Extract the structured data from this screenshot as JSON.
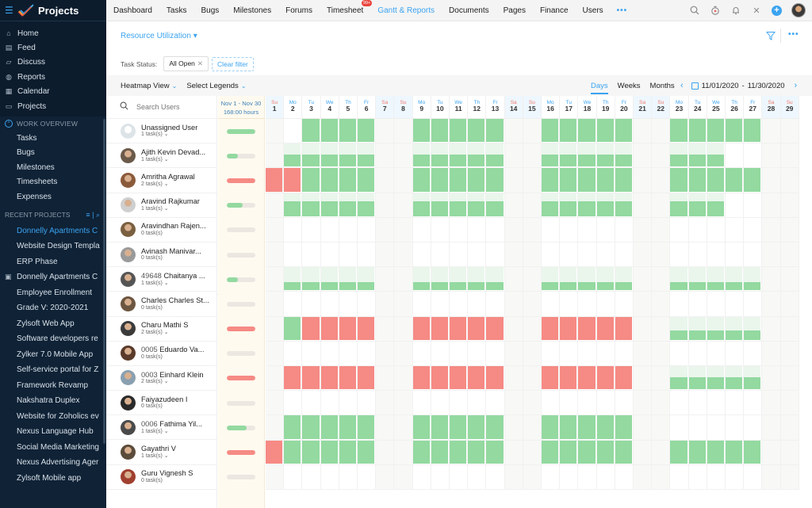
{
  "sidebar": {
    "app_title": "Projects",
    "main_items": [
      {
        "label": "Home",
        "icon": "home-icon",
        "glyph": "⌂"
      },
      {
        "label": "Feed",
        "icon": "feed-icon",
        "glyph": "▤"
      },
      {
        "label": "Discuss",
        "icon": "discuss-icon",
        "glyph": "▱"
      },
      {
        "label": "Reports",
        "icon": "reports-icon",
        "glyph": "◍"
      },
      {
        "label": "Calendar",
        "icon": "calendar-icon",
        "glyph": "▦"
      },
      {
        "label": "Projects",
        "icon": "projects-icon",
        "glyph": "▭"
      }
    ],
    "work_overview_label": "WORK OVERVIEW",
    "work_items": [
      "Tasks",
      "Bugs",
      "Milestones",
      "Timesheets",
      "Expenses"
    ],
    "recent_label": "RECENT PROJECTS",
    "recent_projects": [
      {
        "label": "Donnelly Apartments C",
        "active": true
      },
      {
        "label": "Website Design Templa"
      },
      {
        "label": "ERP Phase"
      },
      {
        "label": "Donnelly Apartments C",
        "icon": true
      },
      {
        "label": "Employee Enrollment"
      },
      {
        "label": "Grade V: 2020-2021"
      },
      {
        "label": "Zylsoft Web App"
      },
      {
        "label": "Software developers re"
      },
      {
        "label": "Zylker 7.0 Mobile App"
      },
      {
        "label": "Self-service portal for Z"
      },
      {
        "label": "Framework Revamp"
      },
      {
        "label": "Nakshatra Duplex"
      },
      {
        "label": "Website for Zoholics ev"
      },
      {
        "label": "Nexus Language Hub"
      },
      {
        "label": "Social Media Marketing"
      },
      {
        "label": "Nexus Advertising Ager"
      },
      {
        "label": "Zylsoft Mobile app"
      }
    ]
  },
  "topnav": {
    "items": [
      "Dashboard",
      "Tasks",
      "Bugs",
      "Milestones",
      "Forums",
      "Timesheet",
      "Gantt & Reports",
      "Documents",
      "Pages",
      "Finance",
      "Users"
    ],
    "active_index": 6,
    "timesheet_badge": "99+",
    "more": "•••"
  },
  "header": {
    "report_selector": "Resource Utilization",
    "task_status_label": "Task Status:",
    "task_status_value": "All Open",
    "clear_filter": "Clear filter",
    "more": "•••"
  },
  "toolbar": {
    "view_selector": "Heatmap View",
    "legends_selector": "Select Legends",
    "views": [
      "Days",
      "Weeks",
      "Months"
    ],
    "active_view": "Days",
    "date_from": "11/01/2020",
    "date_sep": "-",
    "date_to": "11/30/2020"
  },
  "grid": {
    "search_placeholder": "Search Users",
    "summary_range": "Nov 1 - Nov 30",
    "summary_hours": "168:00 hours",
    "days": [
      {
        "d": "Su",
        "n": 1
      },
      {
        "d": "Mo",
        "n": 2
      },
      {
        "d": "Tu",
        "n": 3
      },
      {
        "d": "We",
        "n": 4
      },
      {
        "d": "Th",
        "n": 5
      },
      {
        "d": "Fr",
        "n": 6
      },
      {
        "d": "Sa",
        "n": 7
      },
      {
        "d": "Su",
        "n": 8
      },
      {
        "d": "Mo",
        "n": 9
      },
      {
        "d": "Tu",
        "n": 10
      },
      {
        "d": "We",
        "n": 11
      },
      {
        "d": "Th",
        "n": 12
      },
      {
        "d": "Fr",
        "n": 13
      },
      {
        "d": "Sa",
        "n": 14
      },
      {
        "d": "Su",
        "n": 15
      },
      {
        "d": "Mo",
        "n": 16
      },
      {
        "d": "Tu",
        "n": 17
      },
      {
        "d": "We",
        "n": 18
      },
      {
        "d": "Th",
        "n": 19
      },
      {
        "d": "Fr",
        "n": 20
      },
      {
        "d": "Sa",
        "n": 21
      },
      {
        "d": "Su",
        "n": 22
      },
      {
        "d": "Mo",
        "n": 23
      },
      {
        "d": "Tu",
        "n": 24
      },
      {
        "d": "We",
        "n": 25
      },
      {
        "d": "Th",
        "n": 26
      },
      {
        "d": "Fr",
        "n": 27
      },
      {
        "d": "Sa",
        "n": 28
      },
      {
        "d": "Su",
        "n": 29
      }
    ],
    "colors": {
      "green": "#93d9a0",
      "red": "#f68a84",
      "light": "#eaf6ec",
      "track": "#ede7e2"
    },
    "users": [
      {
        "num": "",
        "name": "Unassigned User",
        "tasks": "1 task(s)",
        "expandable": true,
        "avatar": "#dde4e8",
        "util": {
          "color": "green",
          "pct": 100
        },
        "cells": {
          "g": [
            3,
            4,
            5,
            6,
            9,
            10,
            11,
            12,
            13,
            16,
            17,
            18,
            19,
            20,
            23,
            24,
            25,
            26,
            27
          ]
        }
      },
      {
        "num": "",
        "name": "Ajith Kevin Devad...",
        "tasks": "1 task(s)",
        "expandable": true,
        "avatar": "#6b5a4a",
        "util": {
          "color": "green",
          "pct": 40
        },
        "cells": {
          "p": [
            2,
            3,
            4,
            5,
            6,
            9,
            10,
            11,
            12,
            13,
            16,
            17,
            18,
            19,
            20,
            23,
            24,
            25
          ],
          "pl": 0.5
        }
      },
      {
        "num": "",
        "name": "Amritha Agrawal",
        "tasks": "2 task(s)",
        "expandable": true,
        "avatar": "#8a5b3b",
        "util": {
          "color": "red",
          "pct": 100
        },
        "cells": {
          "r": [
            1,
            2
          ],
          "g": [
            3,
            4,
            5,
            6,
            9,
            10,
            11,
            12,
            13,
            16,
            17,
            18,
            19,
            20,
            23,
            24,
            25,
            26,
            27
          ]
        }
      },
      {
        "num": "",
        "name": "Aravind Rajkumar",
        "tasks": "1 task(s)",
        "expandable": true,
        "avatar": "#cfcfcf",
        "util": {
          "color": "green",
          "pct": 55
        },
        "cells": {
          "p": [
            2,
            3,
            4,
            5,
            6,
            9,
            10,
            11,
            12,
            13,
            16,
            17,
            18,
            19,
            20,
            23,
            24,
            25
          ],
          "pl": 0.62
        }
      },
      {
        "num": "",
        "name": "Aravindhan Rajen...",
        "tasks": "0 task(s)",
        "expandable": false,
        "avatar": "#7a6040",
        "util": {
          "color": "green",
          "pct": 0
        },
        "cells": {}
      },
      {
        "num": "",
        "name": "Avinash Manivar...",
        "tasks": "0 task(s)",
        "expandable": false,
        "avatar": "#9a9a9a",
        "util": {
          "color": "green",
          "pct": 0
        },
        "cells": {}
      },
      {
        "num": "49648",
        "name": "Chaitanya ...",
        "tasks": "1 task(s)",
        "expandable": true,
        "avatar": "#555",
        "util": {
          "color": "green",
          "pct": 40
        },
        "cells": {
          "p": [
            2,
            3,
            4,
            5,
            6,
            9,
            10,
            11,
            12,
            13,
            16,
            17,
            18,
            19,
            20,
            23,
            24,
            25,
            26,
            27
          ],
          "pl": 0.35
        }
      },
      {
        "num": "",
        "name": "Charles Charles St...",
        "tasks": "0 task(s)",
        "expandable": false,
        "avatar": "#6d5640",
        "util": {
          "color": "green",
          "pct": 0
        },
        "cells": {}
      },
      {
        "num": "",
        "name": "Charu Mathi S",
        "tasks": "2 task(s)",
        "expandable": true,
        "avatar": "#3b3b3b",
        "util": {
          "color": "red",
          "pct": 100
        },
        "cells": {
          "g": [
            2
          ],
          "r": [
            3,
            4,
            5,
            6,
            9,
            10,
            11,
            12,
            13,
            16,
            17,
            18,
            19,
            20
          ],
          "p": [
            23,
            24,
            25,
            26,
            27
          ],
          "pl": 0.4
        }
      },
      {
        "num": "0005",
        "name": "Eduardo Va...",
        "tasks": "0 task(s)",
        "expandable": false,
        "avatar": "#5a3a2a",
        "util": {
          "color": "green",
          "pct": 0
        },
        "cells": {}
      },
      {
        "num": "0003",
        "name": "Einhard Klein",
        "tasks": "2 task(s)",
        "expandable": true,
        "avatar": "#8aa0b0",
        "util": {
          "color": "red",
          "pct": 100
        },
        "cells": {
          "r": [
            2,
            3,
            4,
            5,
            6,
            9,
            10,
            11,
            12,
            13,
            16,
            17,
            18,
            19,
            20
          ],
          "p": [
            23,
            24,
            25,
            26,
            27
          ],
          "pl": 0.5
        }
      },
      {
        "num": "",
        "name": "Faiyazudeen I",
        "tasks": "0 task(s)",
        "expandable": false,
        "avatar": "#2a2a2a",
        "util": {
          "color": "green",
          "pct": 0
        },
        "cells": {}
      },
      {
        "num": "0006",
        "name": "Fathima Yil...",
        "tasks": "1 task(s)",
        "expandable": true,
        "avatar": "#4a4a4a",
        "util": {
          "color": "green",
          "pct": 70
        },
        "cells": {
          "g": [
            2,
            3,
            4,
            5,
            6,
            9,
            10,
            11,
            12,
            13,
            16,
            17,
            18,
            19,
            20
          ]
        }
      },
      {
        "num": "",
        "name": "Gayathri V",
        "tasks": "1 task(s)",
        "expandable": true,
        "avatar": "#5b4b3b",
        "util": {
          "color": "red",
          "pct": 100
        },
        "cells": {
          "r": [
            1
          ],
          "g": [
            2,
            3,
            4,
            5,
            6,
            9,
            10,
            11,
            12,
            13,
            16,
            17,
            18,
            19,
            20,
            23,
            24,
            25,
            26,
            27
          ]
        }
      },
      {
        "num": "",
        "name": "Guru Vignesh S",
        "tasks": "0 task(s)",
        "expandable": false,
        "avatar": "#a04030",
        "util": {
          "color": "green",
          "pct": 0
        },
        "cells": {}
      }
    ]
  }
}
